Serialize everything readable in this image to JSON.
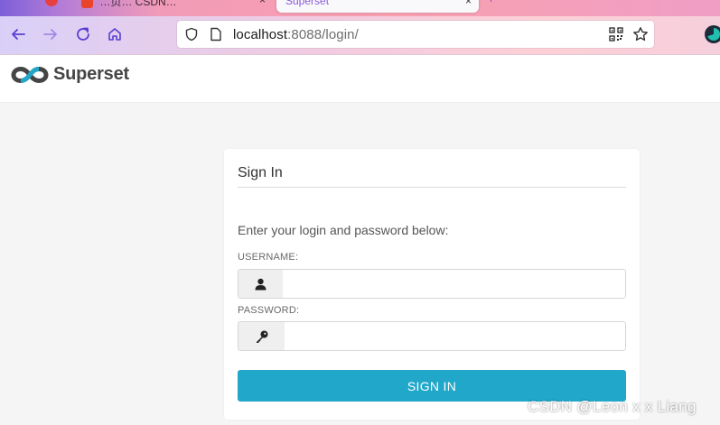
{
  "browser": {
    "tabs": [
      {
        "label": "…页… CSDN…",
        "close": "×"
      },
      {
        "label": "Superset",
        "close": "×"
      }
    ],
    "url_host": "localhost",
    "url_rest": ":8088/login/"
  },
  "app": {
    "brand_name": "Superset"
  },
  "login": {
    "title": "Sign In",
    "intro": "Enter your login and password below:",
    "username_label": "USERNAME:",
    "username_value": "",
    "password_label": "PASSWORD:",
    "password_value": "",
    "submit_label": "SIGN IN"
  },
  "watermark": "CSDN @Leon x x Liang",
  "colors": {
    "accent": "#20a7c9",
    "brand_dark": "#454545",
    "brand_blue": "#20a7c9"
  }
}
